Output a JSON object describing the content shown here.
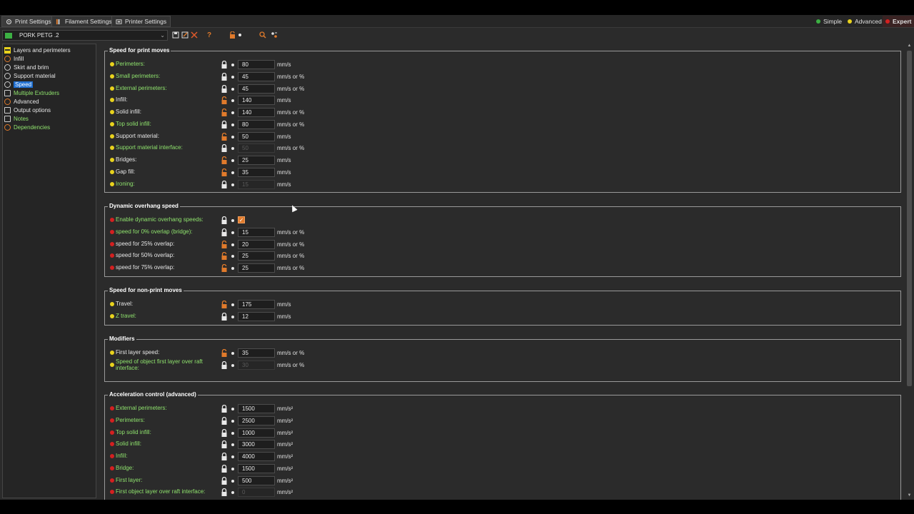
{
  "tabs": [
    {
      "label": "Print Settings",
      "icon": "gear-icon",
      "active": true
    },
    {
      "label": "Filament Settings",
      "icon": "spool-icon",
      "active": false
    },
    {
      "label": "Printer Settings",
      "icon": "printer-icon",
      "active": false
    }
  ],
  "modes": [
    {
      "label": "Simple",
      "color": "#3cb043"
    },
    {
      "label": "Advanced",
      "color": "#e8d21d"
    },
    {
      "label": "Expert",
      "color": "#d42020"
    }
  ],
  "preset": {
    "name": "PORK PETG .2"
  },
  "toolbar": {
    "help": "?"
  },
  "sidebar": {
    "items": [
      {
        "label": "Layers and perimeters",
        "color": "white",
        "icon": "layers-icon"
      },
      {
        "label": "Infill",
        "color": "white",
        "icon": "infill-icon"
      },
      {
        "label": "Skirt and brim",
        "color": "white",
        "icon": "skirt-icon"
      },
      {
        "label": "Support material",
        "color": "white",
        "icon": "support-icon"
      },
      {
        "label": "Speed",
        "color": "white",
        "icon": "speed-icon",
        "selected": true
      },
      {
        "label": "Multiple Extruders",
        "color": "green",
        "icon": "extruders-icon"
      },
      {
        "label": "Advanced",
        "color": "white",
        "icon": "wrench-icon"
      },
      {
        "label": "Output options",
        "color": "white",
        "icon": "output-icon"
      },
      {
        "label": "Notes",
        "color": "green",
        "icon": "notes-icon"
      },
      {
        "label": "Dependencies",
        "color": "green",
        "icon": "dependencies-icon"
      }
    ]
  },
  "groups": [
    {
      "title": "Speed for print moves",
      "rows": [
        {
          "label": "Perimeters:",
          "dot": "yellow",
          "lc": "green",
          "lock": "locked",
          "value": "80",
          "unit": "mm/s"
        },
        {
          "label": "Small perimeters:",
          "dot": "yellow",
          "lc": "green",
          "lock": "locked",
          "value": "45",
          "unit": "mm/s or %"
        },
        {
          "label": "External perimeters:",
          "dot": "yellow",
          "lc": "green",
          "lock": "locked",
          "value": "45",
          "unit": "mm/s or %"
        },
        {
          "label": "Infill:",
          "dot": "yellow",
          "lc": "white",
          "lock": "unlocked",
          "value": "140",
          "unit": "mm/s"
        },
        {
          "label": "Solid infill:",
          "dot": "yellow",
          "lc": "white",
          "lock": "unlocked",
          "value": "140",
          "unit": "mm/s or %"
        },
        {
          "label": "Top solid infill:",
          "dot": "yellow",
          "lc": "green",
          "lock": "locked",
          "value": "80",
          "unit": "mm/s or %"
        },
        {
          "label": "Support material:",
          "dot": "yellow",
          "lc": "white",
          "lock": "unlocked",
          "value": "50",
          "unit": "mm/s"
        },
        {
          "label": "Support material interface:",
          "dot": "yellow",
          "lc": "green",
          "lock": "locked",
          "value": "50",
          "unit": "mm/s or %",
          "disabled": true
        },
        {
          "label": "Bridges:",
          "dot": "yellow",
          "lc": "white",
          "lock": "unlocked",
          "value": "25",
          "unit": "mm/s"
        },
        {
          "label": "Gap fill:",
          "dot": "yellow",
          "lc": "white",
          "lock": "unlocked",
          "value": "35",
          "unit": "mm/s"
        },
        {
          "label": "Ironing:",
          "dot": "yellow",
          "lc": "green",
          "lock": "locked",
          "value": "15",
          "unit": "mm/s",
          "disabled": true
        }
      ]
    },
    {
      "title": "Dynamic overhang speed",
      "rows": [
        {
          "label": "Enable dynamic overhang speeds:",
          "dot": "red",
          "lc": "green",
          "lock": "locked",
          "checkbox": true,
          "checkmark": "✓"
        },
        {
          "label": "speed for 0% overlap (bridge):",
          "dot": "red",
          "lc": "green",
          "lock": "locked",
          "value": "15",
          "unit": "mm/s or %"
        },
        {
          "label": "speed for 25% overlap:",
          "dot": "red",
          "lc": "white",
          "lock": "unlocked",
          "value": "20",
          "unit": "mm/s or %"
        },
        {
          "label": "speed for 50% overlap:",
          "dot": "red",
          "lc": "white",
          "lock": "unlocked",
          "value": "25",
          "unit": "mm/s or %"
        },
        {
          "label": "speed for 75% overlap:",
          "dot": "red",
          "lc": "white",
          "lock": "unlocked",
          "value": "25",
          "unit": "mm/s or %"
        }
      ]
    },
    {
      "title": "Speed for non-print moves",
      "rows": [
        {
          "label": "Travel:",
          "dot": "yellow",
          "lc": "white",
          "lock": "unlocked",
          "value": "175",
          "unit": "mm/s"
        },
        {
          "label": "Z travel:",
          "dot": "yellow",
          "lc": "green",
          "lock": "locked",
          "value": "12",
          "unit": "mm/s"
        }
      ]
    },
    {
      "title": "Modifiers",
      "rows": [
        {
          "label": "First layer speed:",
          "dot": "yellow",
          "lc": "white",
          "lock": "unlocked",
          "value": "35",
          "unit": "mm/s or %"
        },
        {
          "label": "Speed of object first layer over raft interface:",
          "dot": "yellow",
          "lc": "green",
          "lock": "locked",
          "value": "30",
          "unit": "mm/s or %",
          "disabled": true,
          "two": true
        }
      ]
    },
    {
      "title": "Acceleration control (advanced)",
      "rows": [
        {
          "label": "External perimeters:",
          "dot": "red",
          "lc": "green",
          "lock": "locked",
          "value": "1500",
          "unit": "mm/s²"
        },
        {
          "label": "Perimeters:",
          "dot": "red",
          "lc": "green",
          "lock": "locked",
          "value": "2500",
          "unit": "mm/s²"
        },
        {
          "label": "Top solid infill:",
          "dot": "red",
          "lc": "green",
          "lock": "locked",
          "value": "1000",
          "unit": "mm/s²"
        },
        {
          "label": "Solid infill:",
          "dot": "red",
          "lc": "green",
          "lock": "locked",
          "value": "3000",
          "unit": "mm/s²"
        },
        {
          "label": "Infill:",
          "dot": "red",
          "lc": "green",
          "lock": "locked",
          "value": "4000",
          "unit": "mm/s²"
        },
        {
          "label": "Bridge:",
          "dot": "red",
          "lc": "green",
          "lock": "locked",
          "value": "1500",
          "unit": "mm/s²"
        },
        {
          "label": "First layer:",
          "dot": "red",
          "lc": "green",
          "lock": "locked",
          "value": "500",
          "unit": "mm/s²"
        },
        {
          "label": "First object layer over raft interface:",
          "dot": "red",
          "lc": "green",
          "lock": "locked",
          "value": "0",
          "unit": "mm/s²",
          "disabled": true
        }
      ]
    }
  ]
}
